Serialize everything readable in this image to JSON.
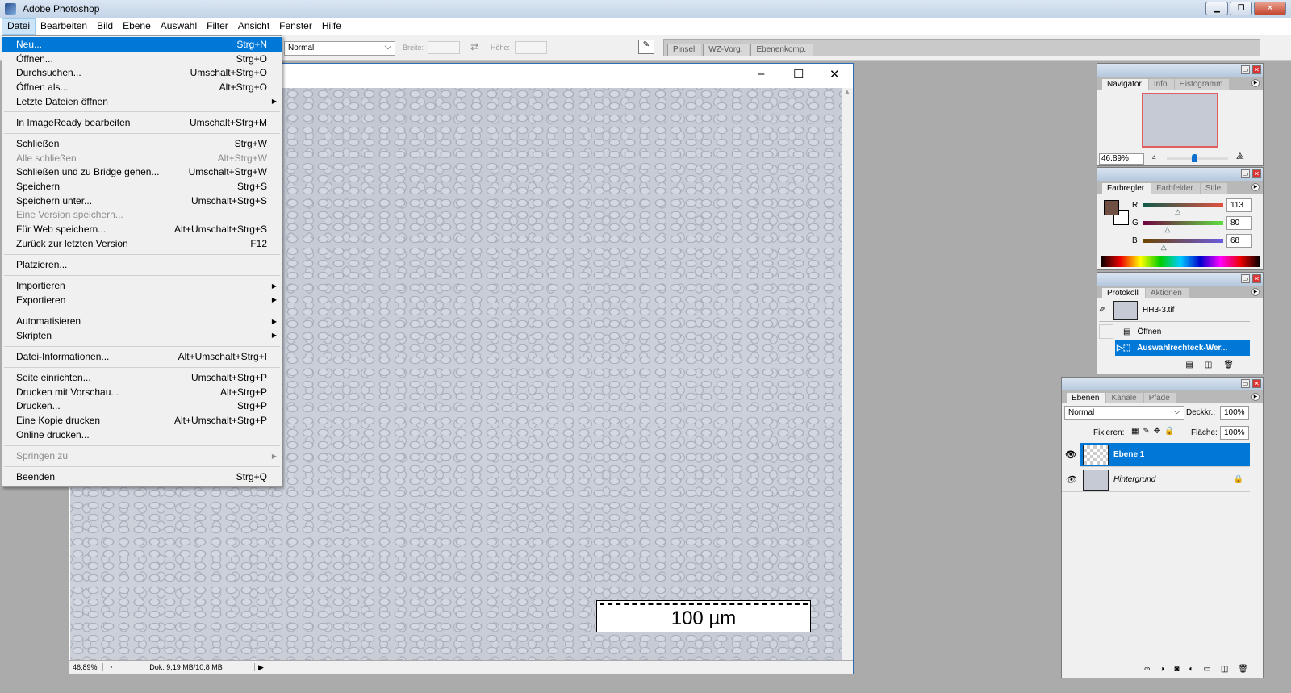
{
  "app": {
    "title": "Adobe Photoshop"
  },
  "menubar": [
    "Datei",
    "Bearbeiten",
    "Bild",
    "Ebene",
    "Auswahl",
    "Filter",
    "Ansicht",
    "Fenster",
    "Hilfe"
  ],
  "options": {
    "mode": "Normal",
    "width_label": "Breite:",
    "height_label": "Höhe:"
  },
  "palette_well": [
    "Pinsel",
    "WZ-Vorg.",
    "Ebenenkomp."
  ],
  "file_menu": [
    {
      "label": "Neu...",
      "shortcut": "Strg+N",
      "state": "highlight"
    },
    {
      "label": "Öffnen...",
      "shortcut": "Strg+O"
    },
    {
      "label": "Durchsuchen...",
      "shortcut": "Umschalt+Strg+O"
    },
    {
      "label": "Öffnen als...",
      "shortcut": "Alt+Strg+O"
    },
    {
      "label": "Letzte Dateien öffnen",
      "submenu": true
    },
    {
      "sep": true
    },
    {
      "label": "In ImageReady bearbeiten",
      "shortcut": "Umschalt+Strg+M"
    },
    {
      "sep": true
    },
    {
      "label": "Schließen",
      "shortcut": "Strg+W"
    },
    {
      "label": "Alle schließen",
      "shortcut": "Alt+Strg+W",
      "state": "disabled"
    },
    {
      "label": "Schließen und zu Bridge gehen...",
      "shortcut": "Umschalt+Strg+W"
    },
    {
      "label": "Speichern",
      "shortcut": "Strg+S"
    },
    {
      "label": "Speichern unter...",
      "shortcut": "Umschalt+Strg+S"
    },
    {
      "label": "Eine Version speichern...",
      "state": "disabled"
    },
    {
      "label": "Für Web speichern...",
      "shortcut": "Alt+Umschalt+Strg+S"
    },
    {
      "label": "Zurück zur letzten Version",
      "shortcut": "F12"
    },
    {
      "sep": true
    },
    {
      "label": "Platzieren..."
    },
    {
      "sep": true
    },
    {
      "label": "Importieren",
      "submenu": true
    },
    {
      "label": "Exportieren",
      "submenu": true
    },
    {
      "sep": true
    },
    {
      "label": "Automatisieren",
      "submenu": true
    },
    {
      "label": "Skripten",
      "submenu": true
    },
    {
      "sep": true
    },
    {
      "label": "Datei-Informationen...",
      "shortcut": "Alt+Umschalt+Strg+I"
    },
    {
      "sep": true
    },
    {
      "label": "Seite einrichten...",
      "shortcut": "Umschalt+Strg+P"
    },
    {
      "label": "Drucken mit Vorschau...",
      "shortcut": "Alt+Strg+P"
    },
    {
      "label": "Drucken...",
      "shortcut": "Strg+P"
    },
    {
      "label": "Eine Kopie drucken",
      "shortcut": "Alt+Umschalt+Strg+P"
    },
    {
      "label": "Online drucken..."
    },
    {
      "sep": true
    },
    {
      "label": "Springen zu",
      "submenu": true,
      "state": "disabled"
    },
    {
      "sep": true
    },
    {
      "label": "Beenden",
      "shortcut": "Strg+Q"
    }
  ],
  "document": {
    "scale_label": "100 µm",
    "zoom": "46,89%",
    "doc_info": "Dok: 9,19 MB/10,8 MB"
  },
  "navigator": {
    "tabs": [
      "Navigator",
      "Info",
      "Histogramm"
    ],
    "zoom": "46.89%",
    "zoom_slider": 0.45
  },
  "color": {
    "tabs": [
      "Farbregler",
      "Farbfelder",
      "Stile"
    ],
    "fg": "#715044",
    "channels": [
      {
        "label": "R",
        "value": "113",
        "fraction": 0.443
      },
      {
        "label": "G",
        "value": "80",
        "fraction": 0.314
      },
      {
        "label": "B",
        "value": "68",
        "fraction": 0.267
      }
    ]
  },
  "history": {
    "tabs": [
      "Protokoll",
      "Aktionen"
    ],
    "snapshot": "HH3-3.tif",
    "items": [
      "Öffnen",
      "Auswahlrechteck-Wer..."
    ]
  },
  "layers": {
    "tabs": [
      "Ebenen",
      "Kanäle",
      "Pfade"
    ],
    "blend": "Normal",
    "opacity_label": "Deckkr.:",
    "opacity": "100%",
    "lock_label": "Fixieren:",
    "fill_label": "Fläche:",
    "fill": "100%",
    "items": [
      "Ebene 1",
      "Hintergrund"
    ]
  },
  "colors": {
    "accent": "#0078d7"
  }
}
